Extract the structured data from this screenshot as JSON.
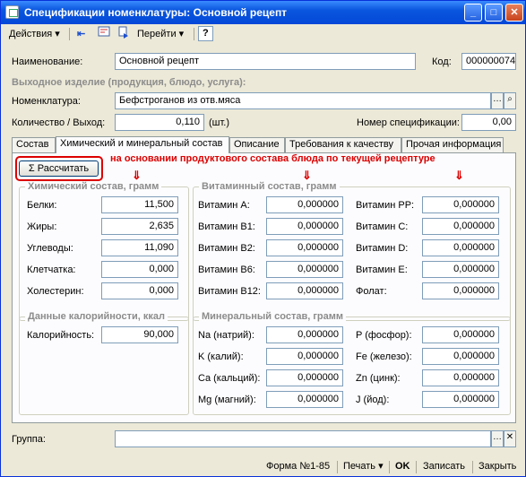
{
  "window": {
    "title": "Спецификации номенклатуры: Основной рецепт"
  },
  "toolbar": {
    "actions": "Действия",
    "goto": "Перейти",
    "help": "?"
  },
  "form": {
    "name_label": "Наименование:",
    "name_value": "Основной рецепт",
    "code_label": "Код:",
    "code_value": "000000074",
    "output_header": "Выходное изделие (продукция, блюдо, услуга):",
    "nomenclature_label": "Номенклатура:",
    "nomenclature_value": "Бефстроганов из отв.мяса",
    "qty_label": "Количество / Выход:",
    "qty_value": "0,110",
    "qty_unit": "(шт.)",
    "spec_no_label": "Номер спецификации:",
    "spec_no_value": "0,00",
    "group_label": "Группа:",
    "group_value": ""
  },
  "tabs": [
    {
      "label": "Состав"
    },
    {
      "label": "Химический и минеральный состав"
    },
    {
      "label": "Описание"
    },
    {
      "label": "Требования к качеству"
    },
    {
      "label": "Прочая информация"
    }
  ],
  "calc_button": "Рассчитать",
  "annotation": "на основании продуктового состава блюда по текущей рецептуре",
  "chem": {
    "title": "Химический состав, грамм",
    "rows": [
      {
        "label": "Белки:",
        "value": "11,500"
      },
      {
        "label": "Жиры:",
        "value": "2,635"
      },
      {
        "label": "Углеводы:",
        "value": "11,090"
      },
      {
        "label": "Клетчатка:",
        "value": "0,000"
      },
      {
        "label": "Холестерин:",
        "value": "0,000"
      }
    ]
  },
  "vitamins": {
    "title": "Витаминный состав, грамм",
    "left": [
      {
        "label": "Витамин А:",
        "value": "0,000000"
      },
      {
        "label": "Витамин В1:",
        "value": "0,000000"
      },
      {
        "label": "Витамин В2:",
        "value": "0,000000"
      },
      {
        "label": "Витамин В6:",
        "value": "0,000000"
      },
      {
        "label": "Витамин В12:",
        "value": "0,000000"
      }
    ],
    "right": [
      {
        "label": "Витамин PP:",
        "value": "0,000000"
      },
      {
        "label": "Витамин С:",
        "value": "0,000000"
      },
      {
        "label": "Витамин D:",
        "value": "0,000000"
      },
      {
        "label": "Витамин Е:",
        "value": "0,000000"
      },
      {
        "label": "Фолат:",
        "value": "0,000000"
      }
    ]
  },
  "calories": {
    "title": "Данные калорийности, ккал",
    "label": "Калорийность:",
    "value": "90,000"
  },
  "minerals": {
    "title": "Минеральный состав, грамм",
    "left": [
      {
        "label": "Na (натрий):",
        "value": "0,000000"
      },
      {
        "label": "K (калий):",
        "value": "0,000000"
      },
      {
        "label": "Ca (кальций):",
        "value": "0,000000"
      },
      {
        "label": "Mg (магний):",
        "value": "0,000000"
      }
    ],
    "right": [
      {
        "label": "P (фосфор):",
        "value": "0,000000"
      },
      {
        "label": "Fe (железо):",
        "value": "0,000000"
      },
      {
        "label": "Zn (цинк):",
        "value": "0,000000"
      },
      {
        "label": "J (йод):",
        "value": "0,000000"
      }
    ]
  },
  "status": {
    "form": "Форма №1-85",
    "print": "Печать",
    "ok": "OK",
    "save": "Записать",
    "close": "Закрыть"
  },
  "colors": {
    "accent": "#d00000",
    "titlebar": "#0a56de"
  }
}
